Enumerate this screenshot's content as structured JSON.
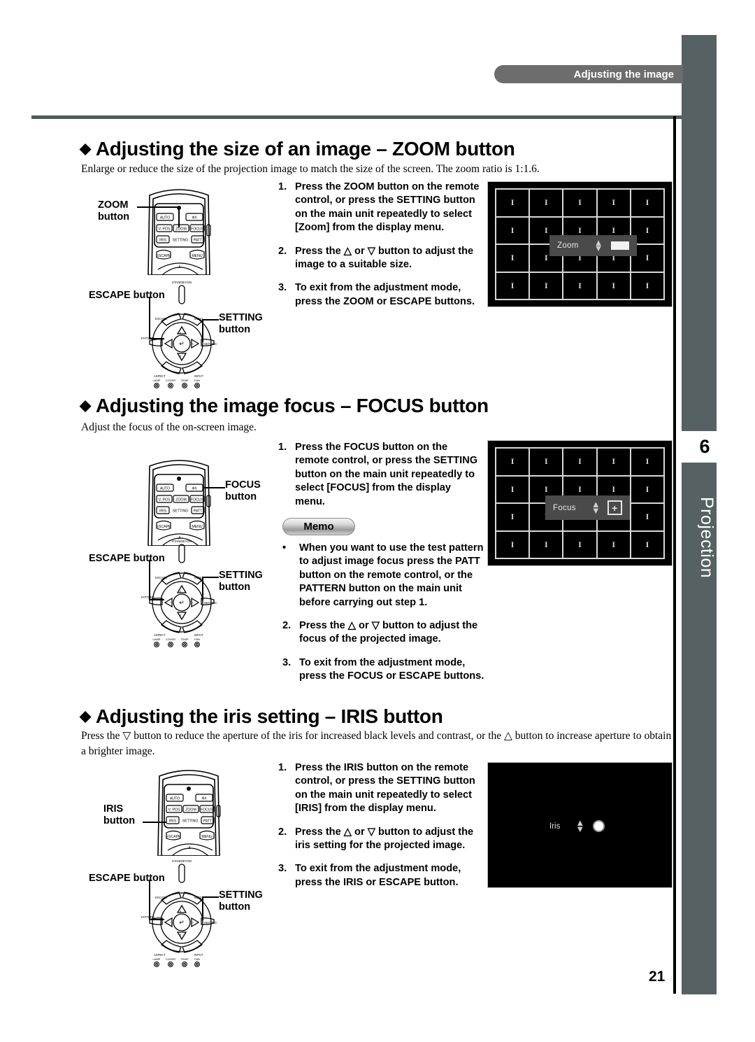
{
  "page": {
    "running_header": "Adjusting the image",
    "side_tab_number": "6",
    "side_tab_label": "Projection",
    "page_number": "21",
    "accent_color": "#566163",
    "header_bar_color": "#6d6d6d"
  },
  "sections": [
    {
      "id": "zoom",
      "diamond": "◆",
      "heading": "Adjusting the size of an image – ZOOM button",
      "intro": "Enlarge or reduce the size of the projection image to match the size of the screen. The zoom ratio is 1:1.6.",
      "steps": [
        {
          "num": "1.",
          "text": "Press the ZOOM button on the remote control, or press the SETTING button on the main unit repeatedly to select [Zoom] from the display menu."
        },
        {
          "num": "2.",
          "text": "Press the △ or ▽ button to adjust the image to a suitable size."
        },
        {
          "num": "3.",
          "text": "To exit from the adjustment mode, press the ZOOM or ESCAPE buttons."
        }
      ],
      "callouts": {
        "remote_button": "ZOOM\nbutton",
        "escape_button": "ESCAPE button",
        "setting_button": "SETTING\nbutton"
      },
      "screen": {
        "type": "test-pattern-grid",
        "cell_glyph": "I",
        "columns": 5,
        "rows": 4,
        "osd_label": "Zoom",
        "osd_indicator": "gauge-bar"
      }
    },
    {
      "id": "focus",
      "diamond": "◆",
      "heading": "Adjusting the image focus – FOCUS button",
      "intro": "Adjust the focus of the on-screen image.",
      "steps": [
        {
          "num": "1.",
          "text": "Press the FOCUS button on the remote control, or press the SETTING button on the main unit repeatedly to select [FOCUS] from the display menu."
        }
      ],
      "memo": {
        "badge": "Memo",
        "items": [
          {
            "num": "•",
            "text": "When you want to use the test pattern to adjust image focus press the PATT button on the remote control, or the PATTERN button on the main unit before carrying out step 1."
          },
          {
            "num": "2.",
            "text": "Press the △ or ▽ button to adjust the  focus of the projected image."
          },
          {
            "num": "3.",
            "text": "To exit from the adjustment mode, press the FOCUS or ESCAPE buttons."
          }
        ]
      },
      "callouts": {
        "remote_button": "FOCUS\nbutton",
        "escape_button": "ESCAPE button",
        "setting_button": "SETTING\nbutton"
      },
      "screen": {
        "type": "test-pattern-grid",
        "cell_glyph": "I",
        "columns": 5,
        "rows": 4,
        "osd_label": "Focus",
        "osd_indicator": "plus-box",
        "osd_plus_glyph": "+"
      }
    },
    {
      "id": "iris",
      "diamond": "◆",
      "heading": "Adjusting the iris setting – IRIS button",
      "intro": "Press the ▽ button to reduce the aperture of the iris for increased black levels and contrast, or the △ button to increase aperture to obtain a brighter image.",
      "steps": [
        {
          "num": "1.",
          "text": "Press the IRIS button on the remote control, or press the SETTING button on the main unit repeatedly to select [IRIS] from the display menu."
        },
        {
          "num": "2.",
          "text": " Press the △ or ▽ button to adjust the  iris setting for the projected image."
        },
        {
          "num": "3.",
          "text": "To exit from the adjustment mode, press the IRIS or ESCAPE button."
        }
      ],
      "callouts": {
        "remote_button": "IRIS\nbutton",
        "escape_button": "ESCAPE button",
        "setting_button": "SETTING\nbutton"
      },
      "screen": {
        "type": "black",
        "osd_label": "Iris",
        "osd_indicator": "circle-dot"
      }
    }
  ],
  "remote_diagram": {
    "indicator_dot": "◉",
    "buttons": [
      "AUTO",
      "Φ/I",
      "V. POS",
      "ZOOM",
      "FOCUS",
      "IRIS",
      "SETTING",
      "PATT",
      "ESCAPE",
      "MENU"
    ]
  },
  "control_panel_diagram": {
    "standby_label": "STANDBY/ON",
    "buttons": [
      "ESCAPE",
      "MENU",
      "PATTERN",
      "SETTING",
      "ASPECT",
      "INPUT"
    ],
    "nav_up": "△",
    "nav_down": "▽",
    "nav_minus": "–",
    "nav_plus": "+",
    "enter_glyph": "↵",
    "indicators": [
      "LAMP",
      "COVER",
      "TEMP",
      "FAN"
    ]
  }
}
